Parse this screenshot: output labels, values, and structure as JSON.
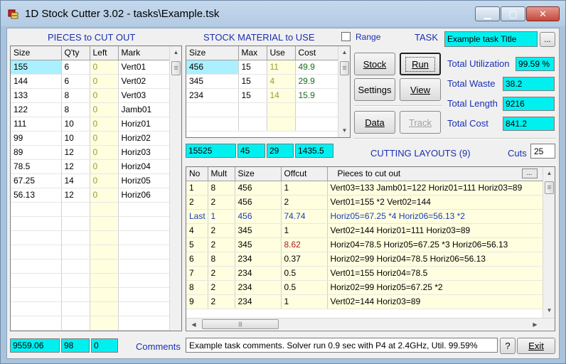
{
  "window": {
    "title": "1D Stock Cutter 3.02  -  tasks\\Example.tsk",
    "min_glyph": "▁",
    "max_glyph": "▢",
    "close_glyph": "✕"
  },
  "pieces": {
    "heading": "PIECES to CUT OUT",
    "columns": [
      "Size",
      "Q'ty",
      "Left",
      "Mark"
    ],
    "rows": [
      {
        "size": "155",
        "qty": "6",
        "left": "0",
        "mark": "Vert01"
      },
      {
        "size": "144",
        "qty": "6",
        "left": "0",
        "mark": "Vert02"
      },
      {
        "size": "133",
        "qty": "8",
        "left": "0",
        "mark": "Vert03"
      },
      {
        "size": "122",
        "qty": "8",
        "left": "0",
        "mark": "Jamb01"
      },
      {
        "size": "111",
        "qty": "10",
        "left": "0",
        "mark": "Horiz01"
      },
      {
        "size": "99",
        "qty": "10",
        "left": "0",
        "mark": "Horiz02"
      },
      {
        "size": "89",
        "qty": "12",
        "left": "0",
        "mark": "Horiz03"
      },
      {
        "size": "78.5",
        "qty": "12",
        "left": "0",
        "mark": "Horiz04"
      },
      {
        "size": "67.25",
        "qty": "14",
        "left": "0",
        "mark": "Horiz05"
      },
      {
        "size": "56.13",
        "qty": "12",
        "left": "0",
        "mark": "Horiz06"
      }
    ],
    "totals": {
      "size": "9559.06",
      "qty": "98",
      "left": "0"
    }
  },
  "stock": {
    "heading": "STOCK MATERIAL to USE",
    "range_label": "Range",
    "columns": [
      "Size",
      "Max",
      "Use",
      "Cost"
    ],
    "rows": [
      {
        "size": "456",
        "max": "15",
        "use": "11",
        "cost": "49.9"
      },
      {
        "size": "345",
        "max": "15",
        "use": "4",
        "cost": "29.9"
      },
      {
        "size": "234",
        "max": "15",
        "use": "14",
        "cost": "15.9"
      }
    ],
    "totals": {
      "size": "15525",
      "max": "45",
      "use": "29",
      "cost": "1435.5"
    }
  },
  "task": {
    "label": "TASK",
    "title": "Example task Title",
    "browse": "...",
    "buttons": {
      "stock": "Stock",
      "run": "Run",
      "settings": "Settings",
      "view": "View",
      "data": "Data",
      "track": "Track"
    },
    "stats": [
      {
        "label": "Total Utilization",
        "value": "99.59 %"
      },
      {
        "label": "Total Waste",
        "value": "38.2"
      },
      {
        "label": "Total Length",
        "value": "9216"
      },
      {
        "label": "Total Cost",
        "value": "841.2"
      }
    ]
  },
  "layouts": {
    "heading": "CUTTING LAYOUTS  (9)",
    "cuts_label": "Cuts",
    "cuts_value": "25",
    "columns": [
      "No",
      "Mult",
      "Size",
      "Offcut",
      "Pieces to cut out"
    ],
    "header_btn": "...",
    "rows": [
      {
        "no": "1",
        "mult": "8",
        "size": "456",
        "offcut": "1",
        "pieces": "Vert03=133   Jamb01=122   Horiz01=111   Horiz03=89",
        "style": "normal"
      },
      {
        "no": "2",
        "mult": "2",
        "size": "456",
        "offcut": "2",
        "pieces": "Vert01=155 *2   Vert02=144",
        "style": "normal"
      },
      {
        "no": "Last",
        "mult": "1",
        "size": "456",
        "offcut": "74.74",
        "pieces": "Horiz05=67.25 *4   Horiz06=56.13 *2",
        "style": "blue"
      },
      {
        "no": "4",
        "mult": "2",
        "size": "345",
        "offcut": "1",
        "pieces": "Vert02=144   Horiz01=111   Horiz03=89",
        "style": "normal"
      },
      {
        "no": "5",
        "mult": "2",
        "size": "345",
        "offcut": "8.62",
        "pieces": "Horiz04=78.5   Horiz05=67.25 *3   Horiz06=56.13",
        "style": "redoff"
      },
      {
        "no": "6",
        "mult": "8",
        "size": "234",
        "offcut": "0.37",
        "pieces": "Horiz02=99   Horiz04=78.5   Horiz06=56.13",
        "style": "normal"
      },
      {
        "no": "7",
        "mult": "2",
        "size": "234",
        "offcut": "0.5",
        "pieces": "Vert01=155   Horiz04=78.5",
        "style": "normal"
      },
      {
        "no": "8",
        "mult": "2",
        "size": "234",
        "offcut": "0.5",
        "pieces": "Horiz02=99   Horiz05=67.25 *2",
        "style": "normal"
      },
      {
        "no": "9",
        "mult": "2",
        "size": "234",
        "offcut": "1",
        "pieces": "Vert02=144   Horiz03=89",
        "style": "normal"
      }
    ],
    "hscroll_thumb": "|||"
  },
  "footer": {
    "comments_label": "Comments",
    "comments": "Example task comments. Solver run 0.9 sec with P4 at 2.4GHz, Util. 99.59%",
    "help": "?",
    "exit": "Exit"
  },
  "colors": {
    "cyan": "#00f0f0",
    "heading_blue": "#1a2fb0",
    "selection": "#aaf0ff",
    "use_yellow": "#ffffe0"
  }
}
